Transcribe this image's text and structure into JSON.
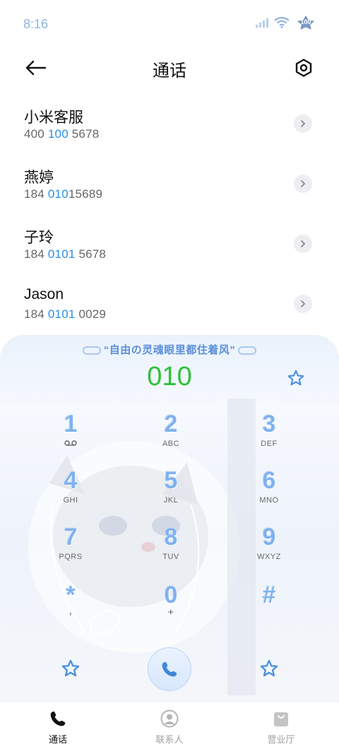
{
  "status": {
    "time": "8:16",
    "battery": "100"
  },
  "header": {
    "title": "通话"
  },
  "contacts": [
    {
      "name": "小米客服",
      "num_pre": "400 ",
      "num_hl": "100",
      "num_post": " 5678"
    },
    {
      "name": "燕婷",
      "num_pre": "184 ",
      "num_hl": "010",
      "num_post": "15689"
    },
    {
      "name": "子玲",
      "num_pre": "184 ",
      "num_hl": "0101",
      "num_post": " 5678"
    },
    {
      "name": "Jason",
      "num_pre": "184 ",
      "num_hl": "0101",
      "num_post": " 0029"
    }
  ],
  "dialer": {
    "quote": "“自由の灵魂眼里都住着风”",
    "number": "010",
    "keys": [
      {
        "digit": "1",
        "sub": ""
      },
      {
        "digit": "2",
        "sub": "ABC"
      },
      {
        "digit": "3",
        "sub": "DEF"
      },
      {
        "digit": "4",
        "sub": "GHI"
      },
      {
        "digit": "5",
        "sub": "JKL"
      },
      {
        "digit": "6",
        "sub": "MNO"
      },
      {
        "digit": "7",
        "sub": "PQRS"
      },
      {
        "digit": "8",
        "sub": "TUV"
      },
      {
        "digit": "9",
        "sub": "WXYZ"
      },
      {
        "digit": "*",
        "sub": ","
      },
      {
        "digit": "0",
        "sub": "+"
      },
      {
        "digit": "#",
        "sub": ""
      }
    ],
    "voicemail_icon": "voicemail-icon"
  },
  "tabs": [
    {
      "label": "通话",
      "icon": "phone-icon",
      "active": true
    },
    {
      "label": "联系人",
      "icon": "person-icon",
      "active": false
    },
    {
      "label": "营业厅",
      "icon": "bag-icon",
      "active": false
    }
  ],
  "colors": {
    "accent": "#2a8fe6",
    "dial_number": "#2cc13a",
    "key_digit": "#7fb2ef"
  }
}
